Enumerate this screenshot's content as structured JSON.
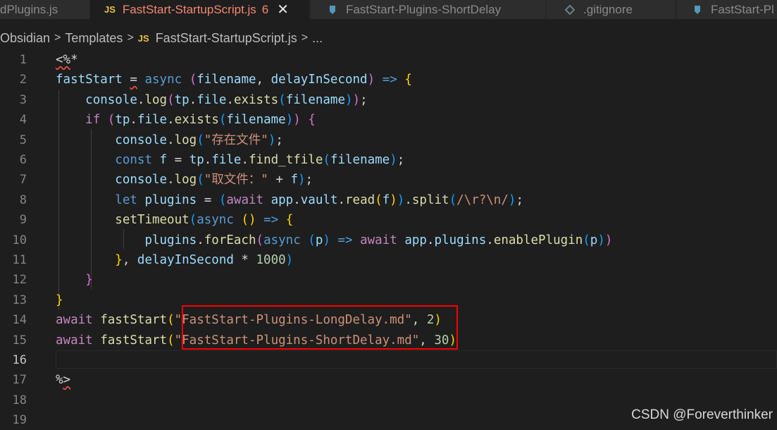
{
  "tabs": [
    {
      "label": "dPlugins.js",
      "icon": "js-file-icon",
      "active": false
    },
    {
      "label": "FastStart-StartupScript.js",
      "badge": "6",
      "icon": "js-file-icon",
      "active": true
    },
    {
      "label": "FastStart-Plugins-ShortDelay",
      "icon": "markdown-file-icon",
      "active": false
    },
    {
      "label": ".gitignore",
      "icon": "gear-file-icon",
      "active": false
    },
    {
      "label": "FastStart-Pl",
      "icon": "markdown-file-icon",
      "active": false
    }
  ],
  "icons": {
    "js": "JS",
    "close": "✕"
  },
  "breadcrumb": {
    "items": [
      "Obsidian",
      "Templates",
      "FastStart-StartupScript.js",
      "..."
    ],
    "separator": ">"
  },
  "line_numbers": [
    "1",
    "2",
    "3",
    "4",
    "5",
    "6",
    "7",
    "8",
    "9",
    "10",
    "11",
    "12",
    "13",
    "14",
    "15",
    "16",
    "17",
    "18",
    "19"
  ],
  "current_line": 16,
  "code_lines": [
    "<%*",
    "fastStart = async (filename, delayInSecond) => {",
    "    console.log(tp.file.exists(filename));",
    "    if (tp.file.exists(filename)) {",
    "        console.log(\"存在文件\");",
    "        const f = tp.file.find_tfile(filename);",
    "        console.log(\"取文件：\" + f);",
    "        let plugins = (await app.vault.read(f)).split(/\\r?\\n/);",
    "        setTimeout(async () => {",
    "            plugins.forEach(async (p) => await app.plugins.enablePlugin(p))",
    "        }, delayInSecond * 1000)",
    "    }",
    "}",
    "await fastStart(\"FastStart-Plugins-LongDelay.md\", 2)",
    "await fastStart(\"FastStart-Plugins-ShortDelay.md\", 30)",
    "",
    "%>",
    "",
    ""
  ],
  "colors": {
    "background": "#1e1e1e",
    "tab_bar": "#252526",
    "active_tab_text": "#f48771",
    "highlight_box": "#ff0000"
  },
  "watermark": "CSDN @Foreverthinker"
}
